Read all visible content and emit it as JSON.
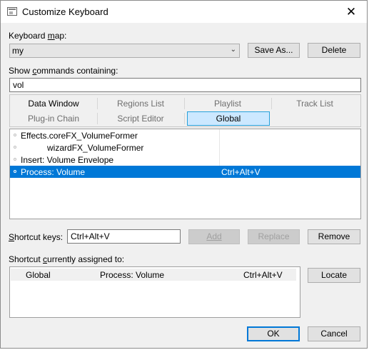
{
  "window": {
    "title": "Customize Keyboard",
    "close_glyph": "✕"
  },
  "keyboard_map": {
    "label_pre": "Keyboard ",
    "label_mnemonic": "m",
    "label_post": "ap:",
    "value": "my",
    "arrow_glyph": "⌄",
    "save_as": "Save As...",
    "delete": "Delete"
  },
  "filter": {
    "label_pre": "Show ",
    "label_mnemonic": "c",
    "label_post": "ommands containing:",
    "value": "vol"
  },
  "tabs": [
    {
      "label": "Data Window"
    },
    {
      "label": "Regions List"
    },
    {
      "label": "Playlist"
    },
    {
      "label": "Track List"
    },
    {
      "label": "Plug-in Chain"
    },
    {
      "label": "Script Editor"
    },
    {
      "label": "Global"
    }
  ],
  "selected_tab": "Global",
  "commands": [
    {
      "name": "Effects.coreFX_VolumeFormer",
      "shortcut": ""
    },
    {
      "name": "wizardFX_VolumeFormer",
      "shortcut": ""
    },
    {
      "name": "Insert: Volume Envelope",
      "shortcut": ""
    },
    {
      "name": "Process: Volume",
      "shortcut": "Ctrl+Alt+V"
    }
  ],
  "shortcut": {
    "label_pre": "",
    "label_mnemonic": "S",
    "label_post": "hortcut keys:",
    "value": "Ctrl+Alt+V",
    "add": "Add",
    "replace": "Replace",
    "remove": "Remove"
  },
  "assigned": {
    "label_pre": "Shortcut ",
    "label_mnemonic": "c",
    "label_post": "urrently assigned to:",
    "rows": [
      {
        "context": "Global",
        "command": "Process: Volume",
        "keys": "Ctrl+Alt+V"
      }
    ],
    "locate": "Locate"
  },
  "footer": {
    "ok": "OK",
    "cancel": "Cancel"
  }
}
